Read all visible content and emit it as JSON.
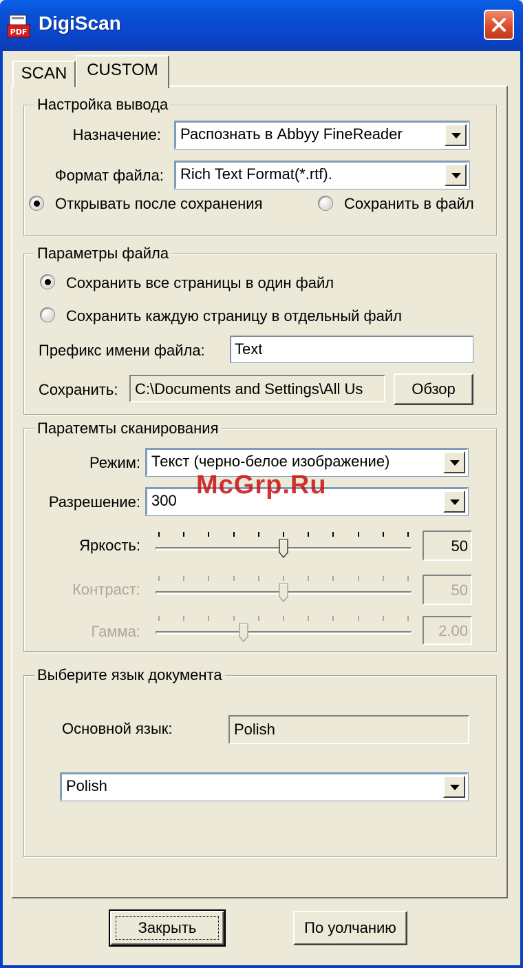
{
  "window": {
    "title": "DigiScan",
    "icon": "pdf-scanner-icon",
    "close_icon": "close-icon"
  },
  "tabs": [
    {
      "label": "SCAN",
      "selected": false
    },
    {
      "label": "CUSTOM",
      "selected": true
    }
  ],
  "output_settings": {
    "legend": "Настройка вывода",
    "destination_label": "Назначение:",
    "destination_value": "Распознать в Abbyy FineReader",
    "format_label": "Формат файла:",
    "format_value": "Rich Text Format(*.rtf).",
    "open_after_save_label": "Открывать после сохранения",
    "open_after_save_checked": true,
    "save_to_file_label": "Сохранить в файл",
    "save_to_file_checked": false
  },
  "file_params": {
    "legend": "Параметры файла",
    "all_pages_one_file_label": "Сохранить все страницы в один файл",
    "all_pages_one_file_checked": true,
    "each_page_separate_label": "Сохранить каждую страницу в отдельный файл",
    "each_page_separate_checked": false,
    "prefix_label": "Префикс имени файла:",
    "prefix_value": "Text",
    "save_path_label": "Сохранить:",
    "save_path_value": "C:\\Documents and Settings\\All Us",
    "browse_label": "Обзор"
  },
  "scan_params": {
    "legend": "Паратемты сканирования",
    "mode_label": "Режим:",
    "mode_value": "Текст (черно-белое изображение)",
    "resolution_label": "Разрешение:",
    "resolution_value": "300",
    "brightness_label": "Яркость:",
    "brightness_value": "50",
    "brightness_level": 0.5,
    "contrast_label": "Контраст:",
    "contrast_value": "50",
    "contrast_level": 0.5,
    "gamma_label": "Гамма:",
    "gamma_value": "2.00",
    "gamma_level": 0.34
  },
  "language": {
    "legend": "Выберите язык документа",
    "primary_label": "Основной язык:",
    "primary_value": "Polish",
    "select_value": "Polish"
  },
  "buttons": {
    "close_label": "Закрыть",
    "default_label": "По уолчанию"
  },
  "watermark": "McGrp.Ru",
  "colors": {
    "titlebar": "#0a4fd6",
    "window_bg": "#ece9d8",
    "disabled_text": "#aca899",
    "watermark": "#cc1111"
  }
}
